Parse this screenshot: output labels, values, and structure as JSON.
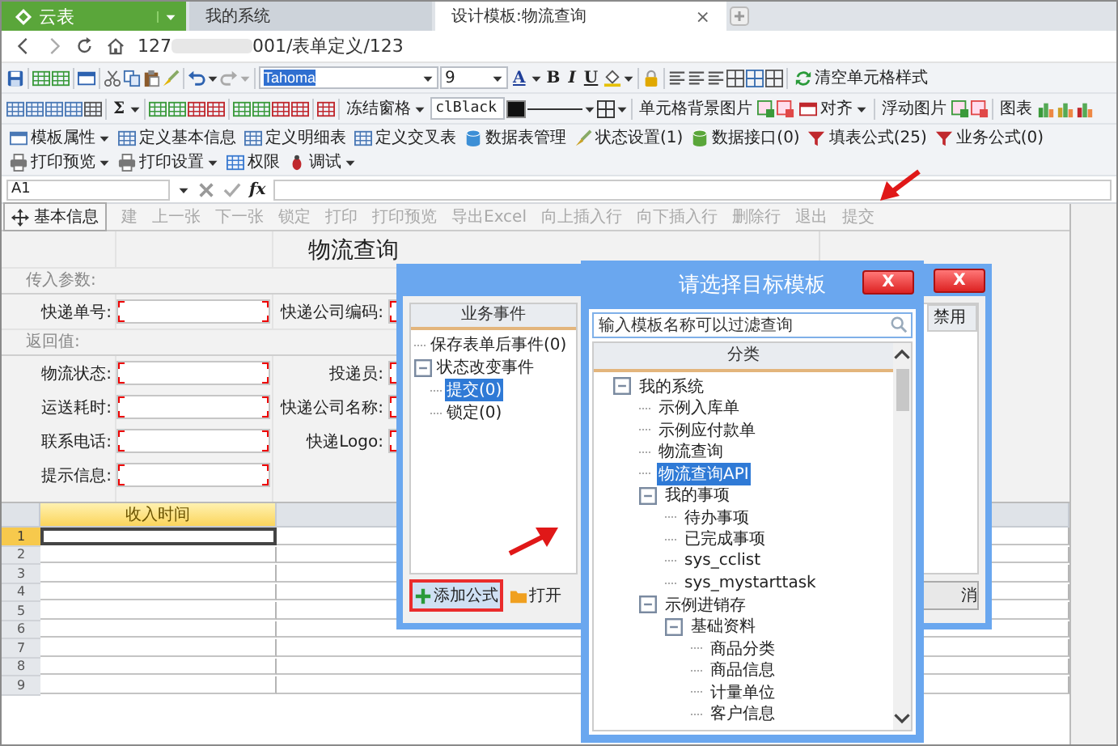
{
  "browser_tabs": [
    {
      "label": "云表",
      "kind": "logo",
      "selected": false
    },
    {
      "label": "我的系统",
      "kind": "tab",
      "selected": false
    },
    {
      "label": "设计模板:物流查询",
      "kind": "tab",
      "selected": true,
      "close": "×"
    }
  ],
  "address_bar": {
    "url_start": "127",
    "url_end": "001/表单定义/123"
  },
  "toolbar_1": {
    "font": "Tahoma",
    "size": "9",
    "font_color": "A",
    "bold": "B",
    "italic": "I",
    "underline": "U",
    "clear_label": "清空单元格样式"
  },
  "toolbar_2": {
    "sum": "Σ",
    "freeze": "冻结窗格",
    "color_value": "clBlack",
    "bg_image": "单元格背景图片",
    "align": "对齐",
    "float_image": "浮动图片",
    "chart": "图表"
  },
  "toolbar_3": [
    {
      "label": "模板属性",
      "dropdown": true
    },
    {
      "label": "定义基本信息",
      "dropdown": false
    },
    {
      "label": "定义明细表",
      "dropdown": false
    },
    {
      "label": "定义交叉表",
      "dropdown": false
    },
    {
      "label": "数据表管理",
      "dropdown": false
    },
    {
      "label": "状态设置(1)",
      "dropdown": false
    },
    {
      "label": "数据接口(0)",
      "dropdown": false
    },
    {
      "label": "填表公式(25)",
      "dropdown": false
    },
    {
      "label": "业务公式(0)",
      "dropdown": false
    },
    {
      "label": "打印预览",
      "dropdown": true
    },
    {
      "label": "打印设置",
      "dropdown": true
    },
    {
      "label": "权限",
      "dropdown": false
    },
    {
      "label": "调试",
      "dropdown": true
    }
  ],
  "formula_bar": {
    "cell": "A1",
    "fx": "fx"
  },
  "form_toolbar": {
    "tab": "基本信息",
    "items": [
      {
        "label": "建",
        "disabled": true
      },
      {
        "label": "上一张",
        "disabled": true
      },
      {
        "label": "下一张",
        "disabled": true
      },
      {
        "label": "锁定",
        "disabled": true
      },
      {
        "label": "打印",
        "disabled": true
      },
      {
        "label": "打印预览",
        "disabled": true
      },
      {
        "label": "导出Excel",
        "disabled": true
      },
      {
        "label": "向上插入行",
        "disabled": true
      },
      {
        "label": "向下插入行",
        "disabled": true
      },
      {
        "label": "删除行",
        "disabled": true
      },
      {
        "label": "退出",
        "disabled": true
      },
      {
        "label": "提交",
        "disabled": true
      }
    ]
  },
  "form": {
    "title": "物流查询",
    "sections": [
      {
        "label": "传入参数:",
        "rows": [
          [
            "快递单号:",
            "快递公司编码:"
          ]
        ]
      },
      {
        "label": "返回值:",
        "rows": [
          [
            "物流状态:",
            "投递员:"
          ],
          [
            "运送耗时:",
            "快递公司名称:"
          ],
          [
            "联系电话:",
            "快递Logo:"
          ],
          [
            "提示信息:"
          ]
        ]
      }
    ]
  },
  "grid": {
    "columns": [
      {
        "label": "收入时间",
        "selected": true
      }
    ],
    "rows": [
      {
        "label": "1",
        "selected": true
      },
      {
        "label": "2",
        "selected": false
      },
      {
        "label": "3",
        "selected": false
      },
      {
        "label": "4",
        "selected": false
      },
      {
        "label": "5",
        "selected": false
      },
      {
        "label": "6",
        "selected": false
      },
      {
        "label": "7",
        "selected": false
      },
      {
        "label": "8",
        "selected": false
      },
      {
        "label": "9",
        "selected": false
      }
    ]
  },
  "event_dialog": {
    "close": "X",
    "tree_header": "业务事件",
    "tree": [
      {
        "label": "保存表单后事件(0)",
        "selected": false
      },
      {
        "label": "状态改变事件",
        "selected": false,
        "expanded": true,
        "children": [
          {
            "label": "提交(0)",
            "selected": true
          },
          {
            "label": "锁定(0)",
            "selected": false
          }
        ]
      }
    ],
    "column_header": "禁用",
    "buttons": [
      {
        "label": "添加公式",
        "kind": "add",
        "highlighted": true
      },
      {
        "label": "打开",
        "kind": "open",
        "highlighted": false
      },
      {
        "label": "消",
        "kind": "plain",
        "highlighted": false
      }
    ]
  },
  "template_dialog": {
    "title": "请选择目标模板",
    "close": "X",
    "search": {
      "placeholder": "输入模板名称可以过滤查询"
    },
    "tree_header": "分类",
    "tree": [
      {
        "label": "我的系统",
        "selected": false,
        "expanded": true,
        "children": [
          {
            "label": "示例入库单",
            "selected": false
          },
          {
            "label": "示例应付款单",
            "selected": false
          },
          {
            "label": "物流查询",
            "selected": false
          },
          {
            "label": "物流查询API",
            "selected": true
          },
          {
            "label": "我的事项",
            "selected": false,
            "expanded": true,
            "children": [
              {
                "label": "待办事项",
                "selected": false
              },
              {
                "label": "已完成事项",
                "selected": false
              },
              {
                "label": "sys_cclist",
                "selected": false
              },
              {
                "label": "sys_mystarttask",
                "selected": false
              }
            ]
          },
          {
            "label": "示例进销存",
            "selected": false,
            "expanded": true,
            "children": [
              {
                "label": "基础资料",
                "selected": false,
                "expanded": true,
                "children": [
                  {
                    "label": "商品分类",
                    "selected": false
                  },
                  {
                    "label": "商品信息",
                    "selected": false
                  },
                  {
                    "label": "计量单位",
                    "selected": false
                  },
                  {
                    "label": "客户信息",
                    "selected": false
                  }
                ]
              }
            ]
          }
        ]
      }
    ]
  }
}
